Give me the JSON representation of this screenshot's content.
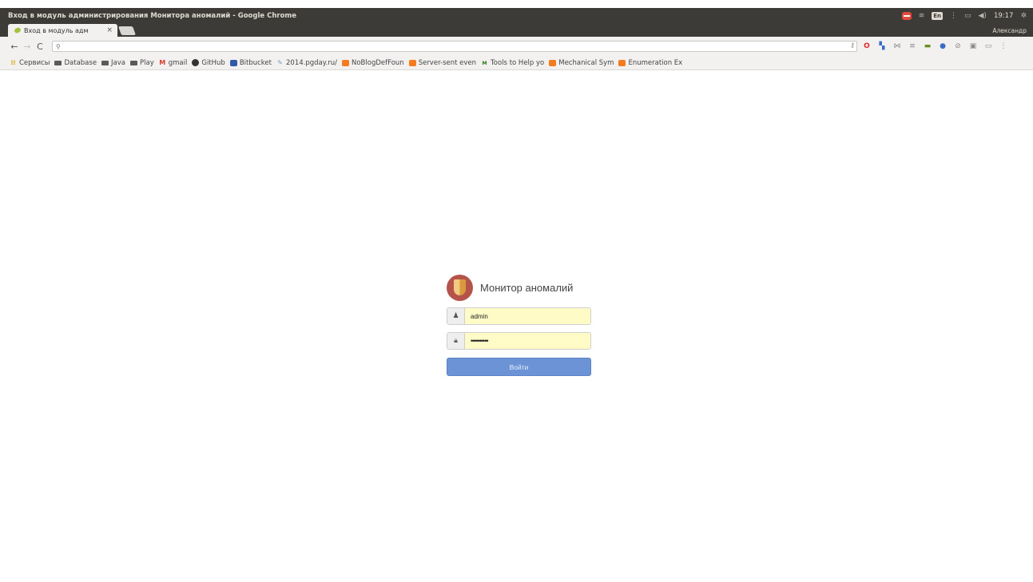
{
  "window": {
    "title": "Вход в модуль администрирования Монитора аномалий - Google Chrome",
    "keyboard_layout": "En",
    "clock": "19:17",
    "profile": "Александр"
  },
  "tab": {
    "title": "Вход в модуль адм",
    "close": "×"
  },
  "toolbar": {
    "back": "←",
    "forward": "→",
    "reload": "C",
    "omnibox_value": ""
  },
  "bookmarks": [
    {
      "label": "Сервисы",
      "icon": "apps-icon"
    },
    {
      "label": "Database",
      "icon": "folder-icon"
    },
    {
      "label": "Java",
      "icon": "folder-icon"
    },
    {
      "label": "Play",
      "icon": "folder-icon"
    },
    {
      "label": "gmail",
      "icon": "gmail-icon"
    },
    {
      "label": "GitHub",
      "icon": "github-icon"
    },
    {
      "label": "Bitbucket",
      "icon": "bitbucket-icon"
    },
    {
      "label": "2014.pgday.ru/",
      "icon": "pgday-icon"
    },
    {
      "label": "NoBlogDefFoun",
      "icon": "blogger-icon"
    },
    {
      "label": "Server-sent even",
      "icon": "blogger-icon"
    },
    {
      "label": "Tools to Help yo",
      "icon": "tools-icon"
    },
    {
      "label": "Mechanical Sym",
      "icon": "blogger-icon"
    },
    {
      "label": "Enumeration Ex",
      "icon": "blogger-icon"
    }
  ],
  "login": {
    "app_title": "Монитор аномалий",
    "username": "admin",
    "password_mask": "••••••••••",
    "submit_label": "Войти"
  },
  "colors": {
    "submit": "#6b93d6",
    "autofill": "#fffbc7",
    "logo_circle": "#b5534a",
    "titlebar": "#3c3b37"
  }
}
